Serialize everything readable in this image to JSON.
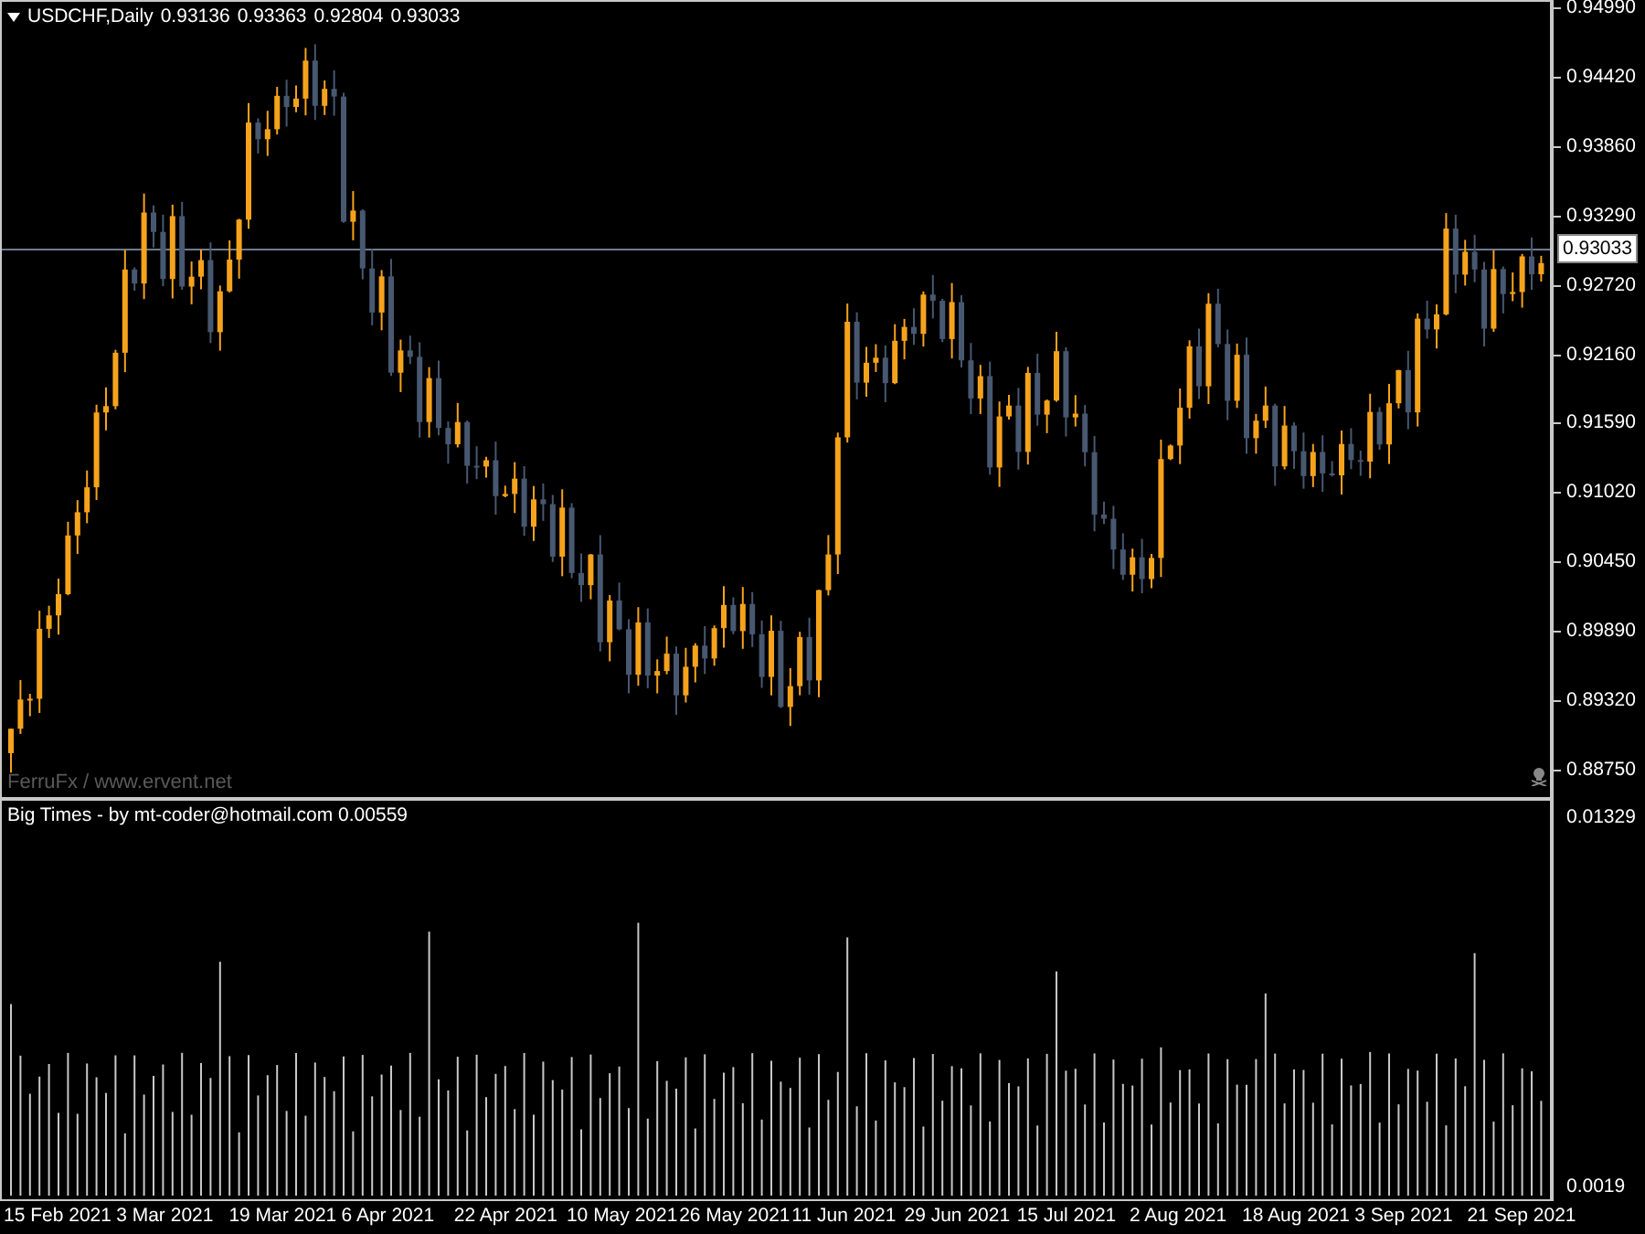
{
  "chart": {
    "symbol": "USDCHF,Daily",
    "ohlc": [
      "0.93136",
      "0.93363",
      "0.92804",
      "0.93033"
    ],
    "price_labels": [
      "0.94990",
      "0.94420",
      "0.93860",
      "0.93290",
      "0.92720",
      "0.92160",
      "0.91590",
      "0.91020",
      "0.90450",
      "0.89890",
      "0.89320",
      "0.88750"
    ],
    "current_price": "0.93033",
    "credit": "FerruFx / www.ervent.net"
  },
  "indicator": {
    "label": "Big Times - by mt-coder@hotmail.com 0.00559",
    "scale_labels": [
      "0.01329",
      "0.0019"
    ]
  },
  "time_axis": [
    "15 Feb 2021",
    "3 Mar 2021",
    "19 Mar 2021",
    "6 Apr 2021",
    "22 Apr 2021",
    "10 May 2021",
    "26 May 2021",
    "11 Jun 2021",
    "29 Jun 2021",
    "15 Jul 2021",
    "2 Aug 2021",
    "18 Aug 2021",
    "3 Sep 2021",
    "21 Sep 2021"
  ]
}
